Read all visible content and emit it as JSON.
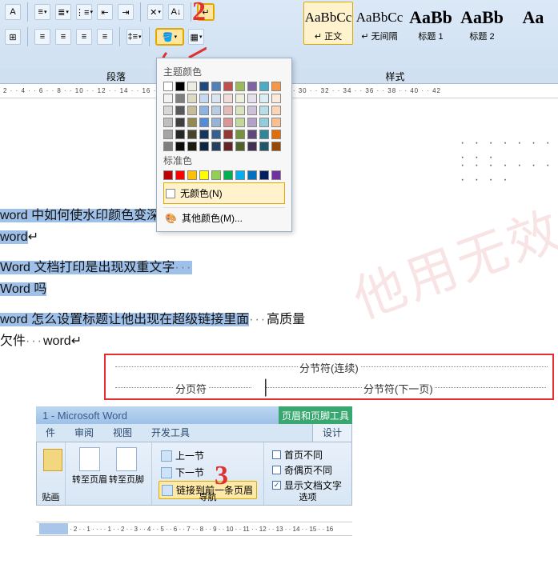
{
  "ribbon1": {
    "group_paragraph": "段落",
    "group_styles": "样式",
    "styles": [
      {
        "sample": "AaBbCc",
        "label": "↵ 正文"
      },
      {
        "sample": "AaBbCc",
        "label": "↵ 无间隔"
      },
      {
        "sample": "AaBb",
        "label": "标题 1"
      },
      {
        "sample": "AaBb",
        "label": "标题 2"
      },
      {
        "sample": "Aa",
        "label": ""
      }
    ]
  },
  "color_popup": {
    "theme_header": "主题颜色",
    "standard_header": "标准色",
    "no_color": "无颜色(N)",
    "more_colors": "其他颜色(M)...",
    "theme_row1": [
      "#ffffff",
      "#000000",
      "#eeece1",
      "#1f497d",
      "#4f81bd",
      "#c0504d",
      "#9bbb59",
      "#8064a2",
      "#4bacc6",
      "#f79646"
    ],
    "theme_tints": [
      [
        "#f2f2f2",
        "#7f7f7f",
        "#ddd9c3",
        "#c6d9f0",
        "#dbe5f1",
        "#f2dcdb",
        "#ebf1dd",
        "#e5e0ec",
        "#dbeef3",
        "#fdeada"
      ],
      [
        "#d8d8d8",
        "#595959",
        "#c4bd97",
        "#8db3e2",
        "#b8cce4",
        "#e5b9b7",
        "#d7e3bc",
        "#ccc1d9",
        "#b7dde8",
        "#fbd5b5"
      ],
      [
        "#bfbfbf",
        "#3f3f3f",
        "#938953",
        "#548dd4",
        "#95b3d7",
        "#d99694",
        "#c3d69b",
        "#b2a2c7",
        "#92cddc",
        "#fac08f"
      ],
      [
        "#a5a5a5",
        "#262626",
        "#494429",
        "#17365d",
        "#366092",
        "#953734",
        "#76923c",
        "#5f497a",
        "#31859b",
        "#e36c09"
      ],
      [
        "#7f7f7f",
        "#0c0c0c",
        "#1d1b10",
        "#0f243e",
        "#244061",
        "#632423",
        "#4f6128",
        "#3f3151",
        "#205867",
        "#974806"
      ]
    ],
    "standard_row": [
      "#c00000",
      "#ff0000",
      "#ffc000",
      "#ffff00",
      "#92d050",
      "#00b050",
      "#00b0f0",
      "#0070c0",
      "#002060",
      "#7030a0"
    ]
  },
  "doc_lines": {
    "l1a": "word 中如何使水印颜色变深",
    "l1b": "高质量",
    "l2": "word",
    "l3": "Word 文档打印是出现双重文字",
    "l4": "Word 吗",
    "l5a": "word 怎么设置标题让他出现在超级链接里面",
    "l5b": "高质量",
    "l6a": "欠件",
    "l6b": "word"
  },
  "breaks": {
    "section_continuous": "分节符(连续)",
    "page_break": "分页符",
    "section_next": "分节符(下一页)"
  },
  "ribbon2": {
    "titlebar": "1 - Microsoft Word",
    "context_label": "页眉和页脚工具",
    "tabs": [
      "件",
      "审阅",
      "视图",
      "开发工具",
      "设计"
    ],
    "goto_header": "转至页眉",
    "goto_footer": "转至页脚",
    "prev_section": "上一节",
    "next_section": "下一节",
    "link_previous": "链接到前一条页眉",
    "nav_label": "导航",
    "opt_first_diff": "首页不同",
    "opt_odd_even": "奇偶页不同",
    "opt_show_text": "显示文档文字",
    "options_label": "选项",
    "pic_label": "贴画"
  },
  "annotations": {
    "num2": "2",
    "num3": "3"
  },
  "ruler_text": "2 · · 4 · · 6 · · 8 · · 10 · · 12 · · 14 · · 16 · · 18 · · 20 · · 22 · · 24 · · 26 · · 28 · · 30 · · 32 · · 34 · · 36 · · 38 · · 40 · · 42",
  "ruler2_text": "· 2 · · 1 · · · · 1 · · 2 · · 3 · · 4 · · 5 · · 6 · · 7 · · 8 · · 9 · · 10 · · 11 · · 12 · · 13 · · 14 · · 15 · · 16"
}
